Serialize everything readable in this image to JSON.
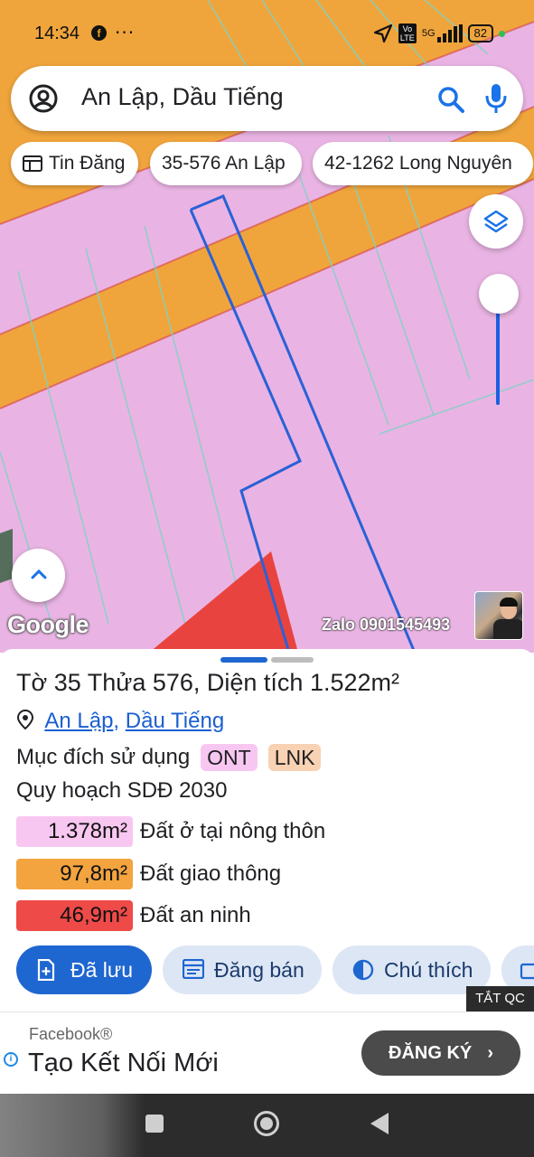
{
  "status_bar": {
    "time": "14:34",
    "notification_icons": [
      "facebook-icon"
    ],
    "more": "···",
    "network": "5G",
    "volte": "Vo LTE",
    "battery": "82"
  },
  "search": {
    "query": "An Lập, Dầu Tiếng",
    "icons": [
      "account-icon",
      "search-icon",
      "mic-icon"
    ]
  },
  "chips": [
    {
      "label": "Tin Đăng",
      "icon": "listing-icon"
    },
    {
      "label": "35-576 An Lập"
    },
    {
      "label": "42-1262 Long Nguyên"
    }
  ],
  "map": {
    "logo": "Google",
    "watermark": "Zalo 0901545493",
    "colors": {
      "residential": "#e9b4e3",
      "traffic": "#f0a53c",
      "security": "#e9433f",
      "boundary": "#2a61d6"
    }
  },
  "sheet": {
    "title": "Tờ 35 Thửa 576, Diện tích 1.522m²",
    "location": {
      "commune": "An Lập",
      "separator": ",",
      "district": "Dầu Tiếng"
    },
    "purpose_label": "Mục đích sử dụng",
    "purpose_tags": [
      "ONT",
      "LNK"
    ],
    "plan_label": "Quy hoạch SDĐ 2030",
    "land_rows": [
      {
        "area": "1.378m²",
        "label": "Đất ở tại nông thôn",
        "color": "#f8c7f1"
      },
      {
        "area": "97,8m²",
        "label": "Đất giao thông",
        "color": "#f3a43f"
      },
      {
        "area": "46,9m²",
        "label": "Đất an ninh",
        "color": "#ee4a48"
      }
    ],
    "actions": [
      {
        "label": "Đã lưu",
        "icon": "bookmark-add-icon"
      },
      {
        "label": "Đăng bán",
        "icon": "post-listing-icon"
      },
      {
        "label": "Chú thích",
        "icon": "legend-icon"
      }
    ]
  },
  "ad": {
    "close_label": "TẮT QC",
    "brand": "Facebook®",
    "headline": "Tạo Kết Nối Mới",
    "cta": "ĐĂNG KÝ"
  }
}
